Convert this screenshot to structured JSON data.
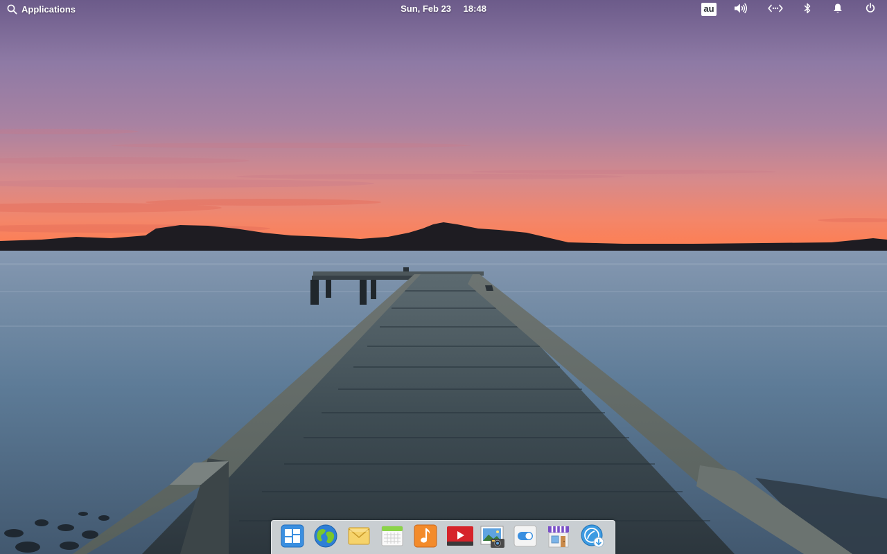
{
  "panel": {
    "applications_label": "Applications",
    "date": "Sun, Feb 23",
    "time": "18:48",
    "keyboard_layout": "au"
  },
  "indicators": [
    "keyboard-layout",
    "sound",
    "network",
    "bluetooth",
    "notifications",
    "power"
  ],
  "dock": {
    "items": [
      {
        "name": "multitasking-view",
        "icon": "multitasking-view-icon"
      },
      {
        "name": "web-browser",
        "icon": "epiphany-globe-icon"
      },
      {
        "name": "mail",
        "icon": "mail-envelope-icon"
      },
      {
        "name": "calendar",
        "icon": "calendar-icon"
      },
      {
        "name": "music",
        "icon": "music-note-icon"
      },
      {
        "name": "videos",
        "icon": "video-play-icon"
      },
      {
        "name": "photos",
        "icon": "photos-camera-icon"
      },
      {
        "name": "system-settings",
        "icon": "settings-toggle-icon"
      },
      {
        "name": "appcenter",
        "icon": "appcenter-store-icon"
      },
      {
        "name": "installer",
        "icon": "installer-download-icon"
      }
    ]
  },
  "colors": {
    "sky_top": "#8a7aa6",
    "sky_horizon": "#ff7e54",
    "water": "#5d7e99",
    "dock_background": "#eceff2"
  }
}
